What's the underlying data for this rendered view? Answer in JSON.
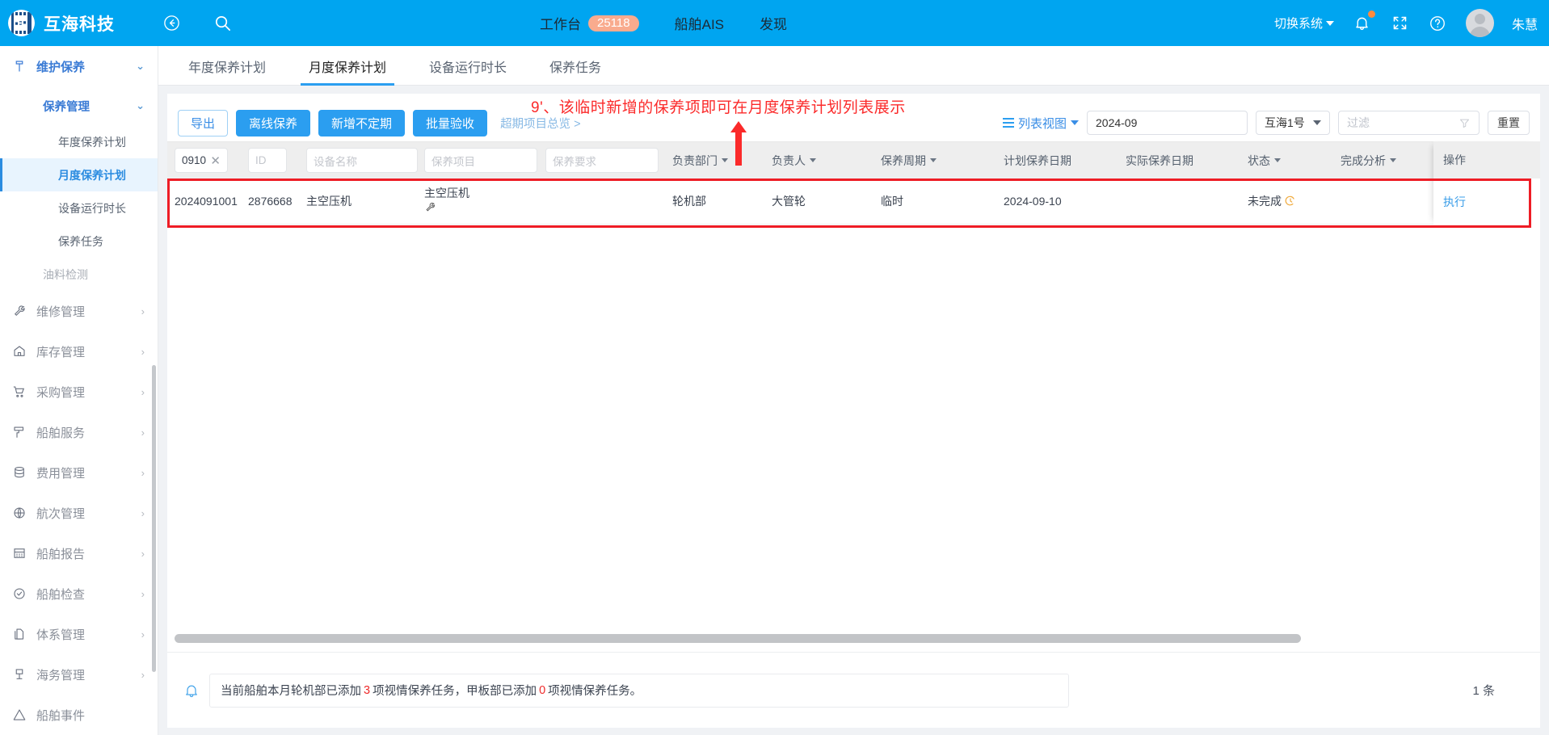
{
  "topbar": {
    "brand": "互海科技",
    "back_icon": "back-circle-icon",
    "search_icon": "search-icon",
    "nav": [
      {
        "label": "工作台",
        "badge": "25118"
      },
      {
        "label": "船舶AIS",
        "badge": ""
      },
      {
        "label": "发现",
        "badge": ""
      }
    ],
    "switch_system": "切换系统",
    "bell_icon": "bell-icon",
    "fullscreen_icon": "fullscreen-icon",
    "help_icon": "help-circle-icon",
    "user_name": "朱慧"
  },
  "sidebar": {
    "l1": {
      "label": "维护保养",
      "icon": "hammer-icon"
    },
    "l2": {
      "label": "保养管理"
    },
    "l3": [
      {
        "label": "年度保养计划",
        "selected": false
      },
      {
        "label": "月度保养计划",
        "selected": true
      },
      {
        "label": "设备运行时长",
        "selected": false
      },
      {
        "label": "保养任务",
        "selected": false
      }
    ],
    "l2b": {
      "label": "油料检测"
    },
    "items": [
      {
        "label": "维修管理",
        "icon": "wrench-icon"
      },
      {
        "label": "库存管理",
        "icon": "home-icon"
      },
      {
        "label": "采购管理",
        "icon": "cart-icon"
      },
      {
        "label": "船舶服务",
        "icon": "roller-icon"
      },
      {
        "label": "费用管理",
        "icon": "database-icon"
      },
      {
        "label": "航次管理",
        "icon": "globe-icon"
      },
      {
        "label": "船舶报告",
        "icon": "calendar-icon"
      },
      {
        "label": "船舶检查",
        "icon": "check-circle-icon"
      },
      {
        "label": "体系管理",
        "icon": "documents-icon"
      },
      {
        "label": "海务管理",
        "icon": "anchor-icon"
      },
      {
        "label": "船舶事件",
        "icon": "warning-icon"
      }
    ]
  },
  "tabs": [
    {
      "label": "年度保养计划",
      "active": false
    },
    {
      "label": "月度保养计划",
      "active": true
    },
    {
      "label": "设备运行时长",
      "active": false
    },
    {
      "label": "保养任务",
      "active": false
    }
  ],
  "toolbar": {
    "export": "导出",
    "offline": "离线保养",
    "add_irregular": "新增不定期",
    "batch_accept": "批量验收",
    "overdue_link": "超期项目总览 >",
    "view_switch": "列表视图",
    "date_value": "2024-09",
    "ship_value": "互海1号",
    "filter_placeholder": "过滤",
    "reset": "重置"
  },
  "annotation": {
    "text": "9'、该临时新增的保养项即可在月度保养计划列表展示"
  },
  "table": {
    "filters": [
      {
        "name": "plan-no-filter",
        "value": "0910",
        "placeholder": "",
        "clearable": true
      },
      {
        "name": "id-filter",
        "value": "",
        "placeholder": "ID",
        "clearable": false
      },
      {
        "name": "equipment-name-filter",
        "value": "",
        "placeholder": "设备名称",
        "clearable": false
      },
      {
        "name": "maintenance-item-filter",
        "value": "",
        "placeholder": "保养项目",
        "clearable": false
      },
      {
        "name": "maintenance-req-filter",
        "value": "",
        "placeholder": "保养要求",
        "clearable": false
      }
    ],
    "headers": [
      {
        "label": "负责部门",
        "sortable": true
      },
      {
        "label": "负责人",
        "sortable": true
      },
      {
        "label": "保养周期",
        "sortable": true
      },
      {
        "label": "计划保养日期",
        "sortable": false
      },
      {
        "label": "实际保养日期",
        "sortable": false
      },
      {
        "label": "状态",
        "sortable": true
      },
      {
        "label": "完成分析",
        "sortable": true
      }
    ],
    "op_header": "操作",
    "rows": [
      {
        "plan_no": "2024091001",
        "id": "2876668",
        "equipment_name": "主空压机",
        "maintenance_item": "主空压机",
        "maintenance_item_icon": "wrench-icon",
        "maintenance_req": "",
        "department": "轮机部",
        "responsible": "大管轮",
        "cycle": "临时",
        "plan_date": "2024-09-10",
        "actual_date": "",
        "status": "未完成",
        "status_icon": "clock-icon",
        "analysis": "",
        "action": "执行"
      }
    ]
  },
  "footer": {
    "note_prefix": "当前船舶本月轮机部已添加 ",
    "note_num1": "3",
    "note_mid": " 项视情保养任务，甲板部已添加 ",
    "note_num2": "0",
    "note_suffix": " 项视情保养任务。",
    "total": "1 条"
  },
  "colors": {
    "brand_blue": "#00a5f0",
    "accent": "#2b9ef0",
    "annotation_red": "#fb2a2a",
    "badge_orange": "#f9ab8e",
    "status_clock": "#f0a93a"
  }
}
